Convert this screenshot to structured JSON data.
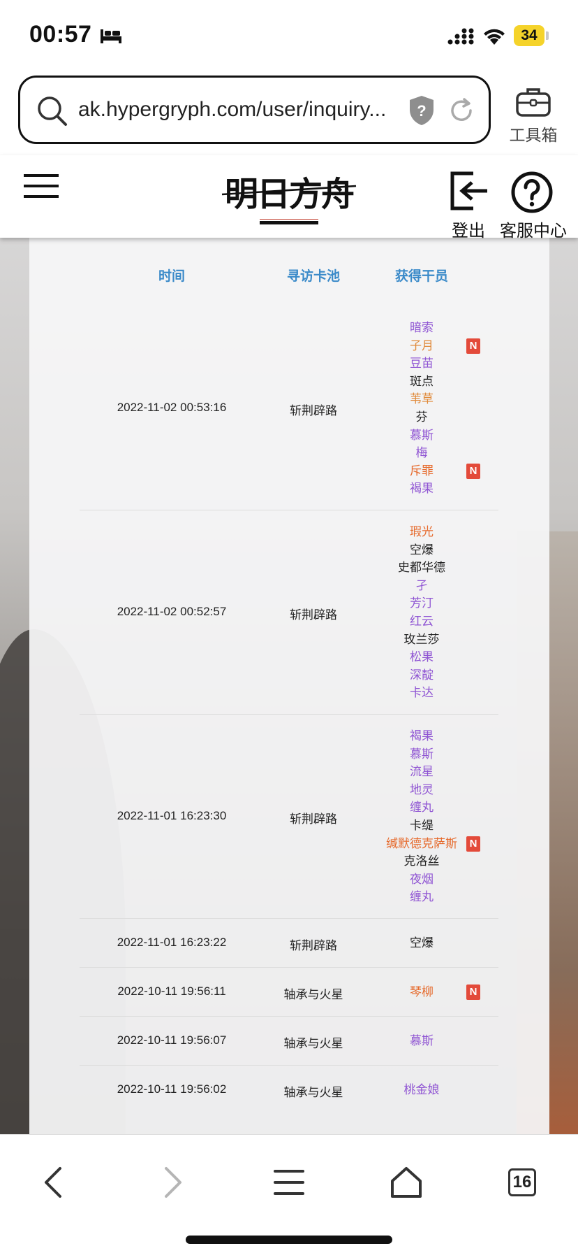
{
  "status_bar": {
    "time": "00:57",
    "battery": "34"
  },
  "browser": {
    "url": "ak.hypergryph.com/user/inquiry...",
    "toolbox_label": "工具箱"
  },
  "header": {
    "logout_label": "登出",
    "support_label": "客服中心",
    "logo_text": "明日方舟"
  },
  "table": {
    "headers": {
      "time": "时间",
      "pool": "寻访卡池",
      "operators": "获得干员"
    },
    "rows": [
      {
        "time": "2022-11-02 00:53:16",
        "pool": "斩荆辟路",
        "operators": [
          {
            "name": "暗索",
            "color": "purple",
            "new": false
          },
          {
            "name": "子月",
            "color": "orange",
            "new": true
          },
          {
            "name": "豆苗",
            "color": "purple",
            "new": false
          },
          {
            "name": "斑点",
            "color": "black",
            "new": false
          },
          {
            "name": "苇草",
            "color": "orange",
            "new": false
          },
          {
            "name": "芬",
            "color": "black",
            "new": false
          },
          {
            "name": "慕斯",
            "color": "purple",
            "new": false
          },
          {
            "name": "梅",
            "color": "purple",
            "new": false
          },
          {
            "name": "斥罪",
            "color": "red-orange",
            "new": true
          },
          {
            "name": "褐果",
            "color": "purple",
            "new": false
          }
        ]
      },
      {
        "time": "2022-11-02 00:52:57",
        "pool": "斩荆辟路",
        "operators": [
          {
            "name": "瑕光",
            "color": "red-orange",
            "new": false
          },
          {
            "name": "空爆",
            "color": "black",
            "new": false
          },
          {
            "name": "史都华德",
            "color": "black",
            "new": false
          },
          {
            "name": "孑",
            "color": "purple",
            "new": false
          },
          {
            "name": "芳汀",
            "color": "purple",
            "new": false
          },
          {
            "name": "红云",
            "color": "purple",
            "new": false
          },
          {
            "name": "玫兰莎",
            "color": "black",
            "new": false
          },
          {
            "name": "松果",
            "color": "purple",
            "new": false
          },
          {
            "name": "深靛",
            "color": "purple",
            "new": false
          },
          {
            "name": "卡达",
            "color": "purple",
            "new": false
          }
        ]
      },
      {
        "time": "2022-11-01 16:23:30",
        "pool": "斩荆辟路",
        "operators": [
          {
            "name": "褐果",
            "color": "purple",
            "new": false
          },
          {
            "name": "慕斯",
            "color": "purple",
            "new": false
          },
          {
            "name": "流星",
            "color": "purple",
            "new": false
          },
          {
            "name": "地灵",
            "color": "purple",
            "new": false
          },
          {
            "name": "缠丸",
            "color": "purple",
            "new": false
          },
          {
            "name": "卡缇",
            "color": "black",
            "new": false
          },
          {
            "name": "缄默德克萨斯",
            "color": "red-orange",
            "new": true
          },
          {
            "name": "克洛丝",
            "color": "black",
            "new": false
          },
          {
            "name": "夜烟",
            "color": "purple",
            "new": false
          },
          {
            "name": "缠丸",
            "color": "purple",
            "new": false
          }
        ]
      },
      {
        "time": "2022-11-01 16:23:22",
        "pool": "斩荆辟路",
        "operators": [
          {
            "name": "空爆",
            "color": "black",
            "new": false
          }
        ]
      },
      {
        "time": "2022-10-11 19:56:11",
        "pool": "轴承与火星",
        "operators": [
          {
            "name": "琴柳",
            "color": "red-orange",
            "new": true
          }
        ]
      },
      {
        "time": "2022-10-11 19:56:07",
        "pool": "轴承与火星",
        "operators": [
          {
            "name": "慕斯",
            "color": "purple",
            "new": false
          }
        ]
      },
      {
        "time": "2022-10-11 19:56:02",
        "pool": "轴承与火星",
        "operators": [
          {
            "name": "桃金娘",
            "color": "purple",
            "new": false
          }
        ]
      }
    ],
    "new_badge_label": "N"
  },
  "bottom_nav": {
    "tab_count": "16"
  },
  "colors": {
    "header_text": "#3a8ac9",
    "purple": "#8f54d3",
    "orange": "#e08a3a",
    "red_orange": "#e66a2c",
    "badge": "#e34a3a"
  },
  "icons": [
    "bed-icon",
    "signal-icon",
    "wifi-icon",
    "search-icon",
    "shield-icon",
    "reload-icon",
    "toolbox-icon",
    "menu-icon",
    "logout-icon",
    "help-icon",
    "back-icon",
    "forward-icon",
    "list-icon",
    "home-icon",
    "tabs-icon"
  ]
}
